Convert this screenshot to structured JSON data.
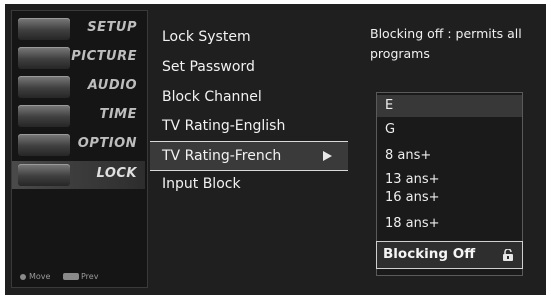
{
  "sidebar": {
    "items": [
      {
        "label": "SETUP",
        "icon": "setup-icon"
      },
      {
        "label": "PICTURE",
        "icon": "picture-icon"
      },
      {
        "label": "AUDIO",
        "icon": "audio-icon"
      },
      {
        "label": "TIME",
        "icon": "time-icon"
      },
      {
        "label": "OPTION",
        "icon": "option-icon"
      },
      {
        "label": "LOCK",
        "icon": "lock-icon",
        "active": true
      }
    ],
    "footer": {
      "move": "Move",
      "prev": "Prev"
    }
  },
  "menu": {
    "items": [
      {
        "label": "Lock System"
      },
      {
        "label": "Set Password"
      },
      {
        "label": "Block Channel"
      },
      {
        "label": "TV Rating-English"
      },
      {
        "label": "TV Rating-French",
        "selected": true
      },
      {
        "label": "Input Block"
      }
    ]
  },
  "panel": {
    "description": "Blocking off : permits all programs",
    "ratings": [
      "E",
      "G",
      "8 ans+",
      "13 ans+",
      "16 ans+",
      "18 ans+"
    ],
    "selected_option": "Blocking Off"
  }
}
